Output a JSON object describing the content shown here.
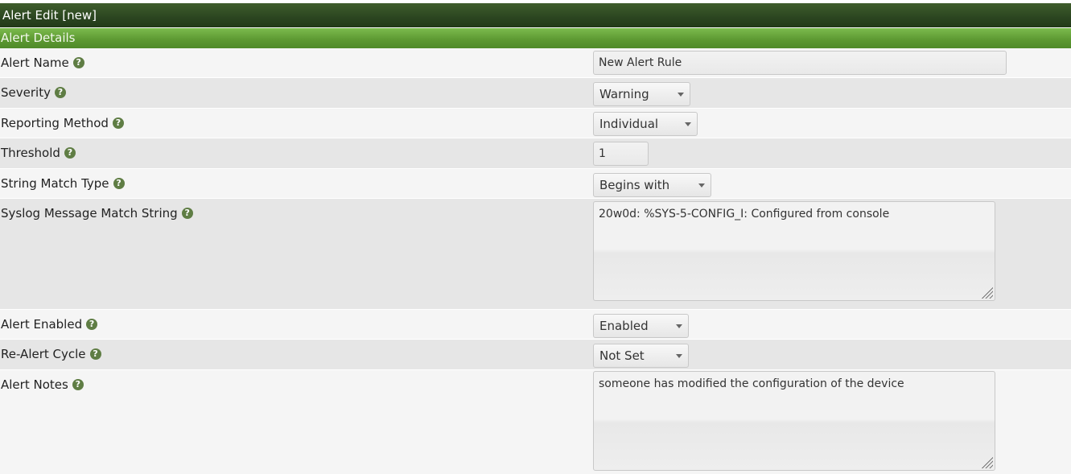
{
  "window": {
    "title": "Alert Edit [new]"
  },
  "section": {
    "title": "Alert Details"
  },
  "help_glyph": "?",
  "fields": {
    "alert_name": {
      "label": "Alert Name",
      "value": "New Alert Rule"
    },
    "severity": {
      "label": "Severity",
      "value": "Warning"
    },
    "reporting_method": {
      "label": "Reporting Method",
      "value": "Individual"
    },
    "threshold": {
      "label": "Threshold",
      "value": "1"
    },
    "string_match_type": {
      "label": "String Match Type",
      "value": "Begins with"
    },
    "syslog_match_string": {
      "label": "Syslog Message Match String",
      "value": "20w0d: %SYS-5-CONFIG_I: Configured from console"
    },
    "alert_enabled": {
      "label": "Alert Enabled",
      "value": "Enabled"
    },
    "realert_cycle": {
      "label": "Re-Alert Cycle",
      "value": "Not Set"
    },
    "alert_notes": {
      "label": "Alert Notes",
      "value": "someone has modified the configuration of the device"
    }
  },
  "colors": {
    "title_bar": "#2b4520",
    "section_bar": "#5e9a33",
    "help_icon": "#5f7d44",
    "row_light": "#f5f5f5",
    "row_dark": "#e6e6e6"
  }
}
